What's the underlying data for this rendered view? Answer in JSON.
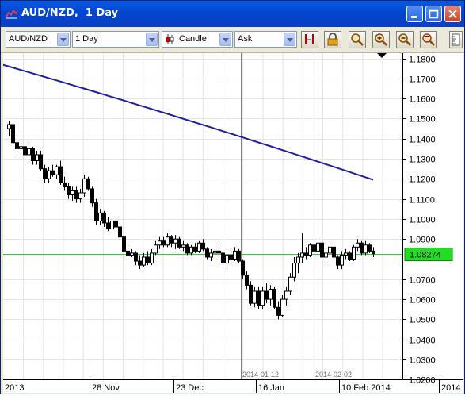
{
  "window": {
    "title": "AUD/NZD,  1 Day",
    "buttons": [
      "minimize",
      "maximize",
      "close"
    ]
  },
  "toolbar": {
    "symbol": "AUD/NZD",
    "period": "1 Day",
    "chart_type": "Candle",
    "price_side": "Ask",
    "icons": [
      "set-marker-icon",
      "lock-icon",
      "zoom-icon",
      "zoom-in-icon",
      "zoom-out-icon",
      "zoom-fit-icon"
    ]
  },
  "colors": {
    "moving_average": "#1e1ea8",
    "current_price_line": "#33cc33",
    "price_tag_bg": "#22dd22",
    "candle_up": "#ffffff",
    "candle_down": "#000000"
  },
  "chart_data": {
    "type": "candlestick",
    "symbol": "AUD/NZD",
    "timeframe": "1 Day",
    "y_axis": {
      "ylim": [
        1.02,
        1.18
      ],
      "ticks": [
        "1.1800",
        "1.1700",
        "1.1600",
        "1.1500",
        "1.1400",
        "1.1300",
        "1.1200",
        "1.1100",
        "1.1000",
        "1.0900",
        "1.0700",
        "1.0600",
        "1.0500",
        "1.0400",
        "1.0300",
        "1.0200"
      ]
    },
    "x_axis": {
      "labels": [
        "2013",
        "28 Nov",
        "23 Dec",
        "16 Jan",
        "10 Feb 2014",
        "2014"
      ]
    },
    "current_price": "1.08274",
    "markers": [
      "2014-01-12",
      "2014-02-02"
    ],
    "moving_average": {
      "start": 1.177,
      "end": 1.1195
    },
    "candles": [
      [
        1.145,
        1.149,
        1.141,
        1.147
      ],
      [
        1.147,
        1.149,
        1.136,
        1.138
      ],
      [
        1.138,
        1.14,
        1.133,
        1.135
      ],
      [
        1.135,
        1.138,
        1.131,
        1.136
      ],
      [
        1.136,
        1.138,
        1.13,
        1.132
      ],
      [
        1.132,
        1.137,
        1.13,
        1.135
      ],
      [
        1.135,
        1.136,
        1.127,
        1.129
      ],
      [
        1.129,
        1.134,
        1.127,
        1.132
      ],
      [
        1.132,
        1.134,
        1.124,
        1.125
      ],
      [
        1.125,
        1.127,
        1.118,
        1.12
      ],
      [
        1.12,
        1.126,
        1.118,
        1.124
      ],
      [
        1.124,
        1.127,
        1.121,
        1.122
      ],
      [
        1.122,
        1.127,
        1.12,
        1.126
      ],
      [
        1.126,
        1.129,
        1.117,
        1.118
      ],
      [
        1.118,
        1.121,
        1.114,
        1.116
      ],
      [
        1.116,
        1.118,
        1.11,
        1.112
      ],
      [
        1.112,
        1.116,
        1.109,
        1.114
      ],
      [
        1.114,
        1.116,
        1.108,
        1.11
      ],
      [
        1.11,
        1.115,
        1.108,
        1.113
      ],
      [
        1.113,
        1.122,
        1.111,
        1.12
      ],
      [
        1.12,
        1.121,
        1.114,
        1.115
      ],
      [
        1.115,
        1.116,
        1.106,
        1.108
      ],
      [
        1.108,
        1.11,
        1.097,
        1.099
      ],
      [
        1.099,
        1.105,
        1.097,
        1.103
      ],
      [
        1.103,
        1.104,
        1.096,
        1.098
      ],
      [
        1.098,
        1.101,
        1.094,
        1.095
      ],
      [
        1.095,
        1.101,
        1.093,
        1.099
      ],
      [
        1.099,
        1.1,
        1.095,
        1.096
      ],
      [
        1.096,
        1.098,
        1.089,
        1.091
      ],
      [
        1.091,
        1.092,
        1.082,
        1.084
      ],
      [
        1.084,
        1.086,
        1.08,
        1.082
      ],
      [
        1.082,
        1.085,
        1.081,
        1.083
      ],
      [
        1.083,
        1.084,
        1.077,
        1.079
      ],
      [
        1.079,
        1.082,
        1.075,
        1.077
      ],
      [
        1.077,
        1.083,
        1.076,
        1.081
      ],
      [
        1.081,
        1.084,
        1.077,
        1.078
      ],
      [
        1.078,
        1.085,
        1.077,
        1.083
      ],
      [
        1.083,
        1.089,
        1.082,
        1.087
      ],
      [
        1.087,
        1.091,
        1.085,
        1.089
      ],
      [
        1.089,
        1.091,
        1.086,
        1.087
      ],
      [
        1.087,
        1.093,
        1.086,
        1.091
      ],
      [
        1.091,
        1.092,
        1.086,
        1.088
      ],
      [
        1.088,
        1.092,
        1.085,
        1.09
      ],
      [
        1.09,
        1.091,
        1.085,
        1.086
      ],
      [
        1.086,
        1.089,
        1.084,
        1.087
      ],
      [
        1.087,
        1.088,
        1.082,
        1.083
      ],
      [
        1.083,
        1.087,
        1.082,
        1.086
      ],
      [
        1.086,
        1.088,
        1.083,
        1.084
      ],
      [
        1.084,
        1.089,
        1.083,
        1.088
      ],
      [
        1.088,
        1.09,
        1.084,
        1.085
      ],
      [
        1.085,
        1.086,
        1.08,
        1.081
      ],
      [
        1.081,
        1.085,
        1.079,
        1.083
      ],
      [
        1.083,
        1.085,
        1.082,
        1.084
      ],
      [
        1.084,
        1.086,
        1.082,
        1.083
      ],
      [
        1.083,
        1.084,
        1.077,
        1.078
      ],
      [
        1.078,
        1.084,
        1.076,
        1.082
      ],
      [
        1.082,
        1.085,
        1.079,
        1.08
      ],
      [
        1.08,
        1.086,
        1.079,
        1.084
      ],
      [
        1.084,
        1.085,
        1.078,
        1.079
      ],
      [
        1.079,
        1.08,
        1.07,
        1.072
      ],
      [
        1.072,
        1.074,
        1.065,
        1.067
      ],
      [
        1.067,
        1.069,
        1.057,
        1.058
      ],
      [
        1.058,
        1.066,
        1.056,
        1.064
      ],
      [
        1.064,
        1.066,
        1.055,
        1.057
      ],
      [
        1.057,
        1.066,
        1.055,
        1.064
      ],
      [
        1.064,
        1.068,
        1.058,
        1.06
      ],
      [
        1.06,
        1.067,
        1.057,
        1.065
      ],
      [
        1.065,
        1.066,
        1.055,
        1.056
      ],
      [
        1.056,
        1.059,
        1.05,
        1.052
      ],
      [
        1.052,
        1.062,
        1.051,
        1.06
      ],
      [
        1.06,
        1.066,
        1.057,
        1.064
      ],
      [
        1.064,
        1.073,
        1.062,
        1.071
      ],
      [
        1.071,
        1.081,
        1.069,
        1.078
      ],
      [
        1.078,
        1.083,
        1.073,
        1.081
      ],
      [
        1.081,
        1.093,
        1.078,
        1.083
      ],
      [
        1.083,
        1.086,
        1.08,
        1.082
      ],
      [
        1.082,
        1.088,
        1.081,
        1.087
      ],
      [
        1.087,
        1.089,
        1.082,
        1.084
      ],
      [
        1.084,
        1.091,
        1.083,
        1.088
      ],
      [
        1.088,
        1.089,
        1.08,
        1.081
      ],
      [
        1.081,
        1.085,
        1.079,
        1.083
      ],
      [
        1.083,
        1.088,
        1.082,
        1.086
      ],
      [
        1.086,
        1.087,
        1.08,
        1.081
      ],
      [
        1.081,
        1.082,
        1.075,
        1.077
      ],
      [
        1.077,
        1.084,
        1.075,
        1.082
      ],
      [
        1.082,
        1.085,
        1.08,
        1.083
      ],
      [
        1.083,
        1.084,
        1.079,
        1.08
      ],
      [
        1.08,
        1.087,
        1.079,
        1.086
      ],
      [
        1.086,
        1.09,
        1.084,
        1.088
      ],
      [
        1.088,
        1.089,
        1.082,
        1.083
      ],
      [
        1.083,
        1.089,
        1.082,
        1.087
      ],
      [
        1.087,
        1.088,
        1.083,
        1.084
      ],
      [
        1.084,
        1.086,
        1.081,
        1.0827
      ]
    ]
  }
}
